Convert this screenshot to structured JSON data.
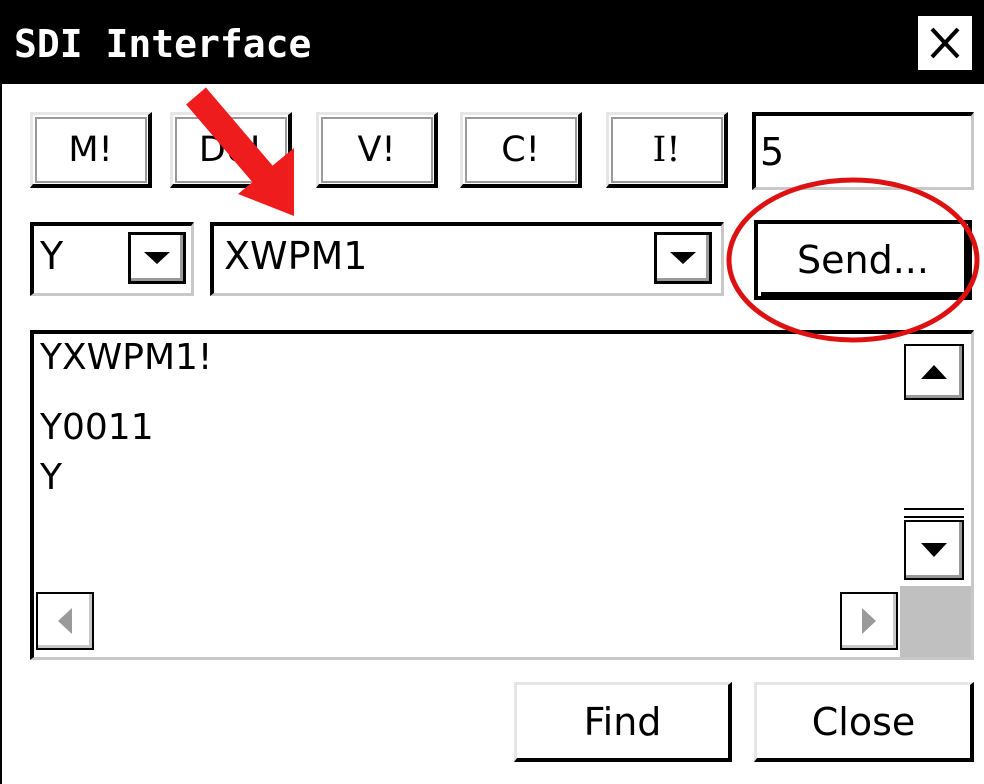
{
  "window": {
    "title": "SDI Interface",
    "close_icon": "close-x-icon"
  },
  "command_buttons": [
    {
      "label": "M!"
    },
    {
      "label": "D0!"
    },
    {
      "label": "V!"
    },
    {
      "label": "C!"
    },
    {
      "label": "I!"
    }
  ],
  "count_field": {
    "value": "5"
  },
  "address_select": {
    "value": "Y"
  },
  "command_select": {
    "value": "XWPM1"
  },
  "send_button": {
    "label": "Send..."
  },
  "log": {
    "lines": [
      "YXWPM1!",
      "Y0011",
      "Y"
    ]
  },
  "footer": {
    "find_label": "Find",
    "close_label": "Close"
  },
  "annotations": {
    "arrow_color": "#ee1c1c",
    "circle_color": "#dd1111"
  }
}
